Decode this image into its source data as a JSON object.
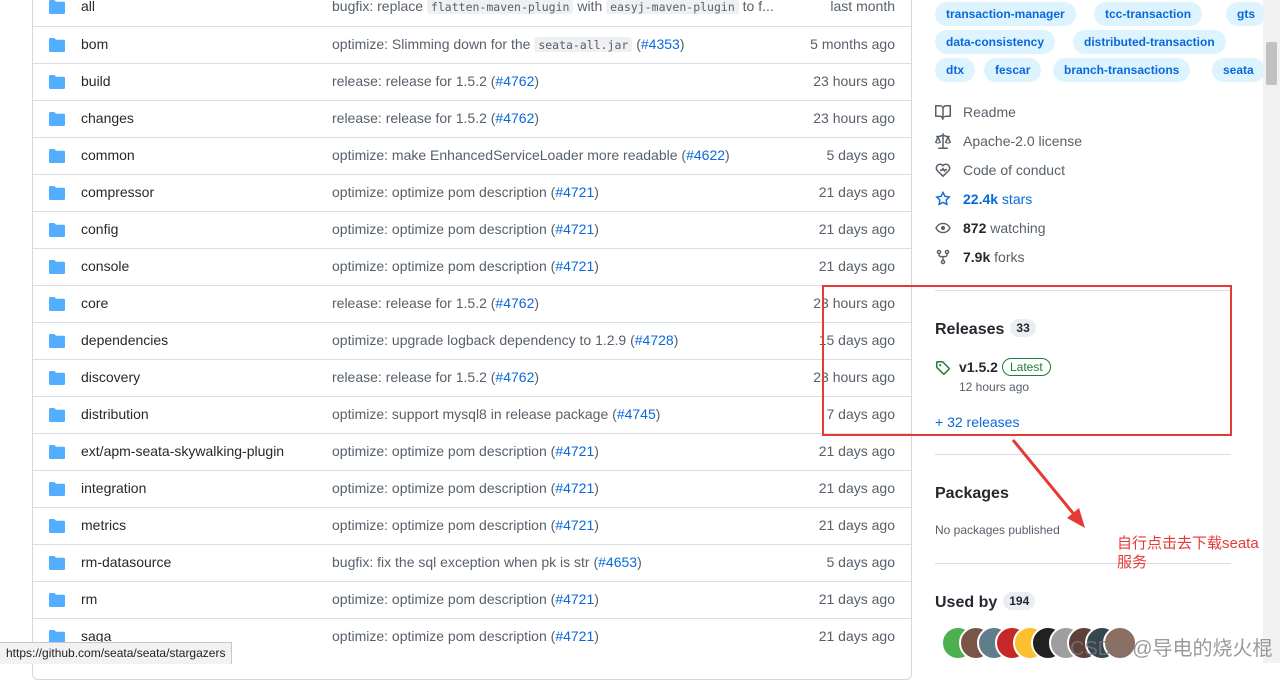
{
  "colors": {
    "folder": "#54aeff",
    "link": "#0969da",
    "muted": "#57606a",
    "tag_bg": "#ddf4ff",
    "annotation": "#e53935",
    "latest": "#1a7f37"
  },
  "files": [
    {
      "name": "all",
      "msg_parts": [
        {
          "t": "text",
          "v": "bugfix: replace "
        },
        {
          "t": "code",
          "v": "flatten-maven-plugin"
        },
        {
          "t": "text",
          "v": " with "
        },
        {
          "t": "code",
          "v": "easyj-maven-plugin"
        },
        {
          "t": "text",
          "v": " to f..."
        }
      ],
      "time": "last month"
    },
    {
      "name": "bom",
      "msg_parts": [
        {
          "t": "text",
          "v": "optimize: Slimming down for the "
        },
        {
          "t": "code",
          "v": "seata-all.jar"
        },
        {
          "t": "text",
          "v": " ("
        },
        {
          "t": "link",
          "v": "#4353"
        },
        {
          "t": "text",
          "v": ")"
        }
      ],
      "time": "5 months ago"
    },
    {
      "name": "build",
      "msg_parts": [
        {
          "t": "text",
          "v": "release: release for 1.5.2 ("
        },
        {
          "t": "link",
          "v": "#4762"
        },
        {
          "t": "text",
          "v": ")"
        }
      ],
      "time": "23 hours ago"
    },
    {
      "name": "changes",
      "msg_parts": [
        {
          "t": "text",
          "v": "release: release for 1.5.2 ("
        },
        {
          "t": "link",
          "v": "#4762"
        },
        {
          "t": "text",
          "v": ")"
        }
      ],
      "time": "23 hours ago"
    },
    {
      "name": "common",
      "msg_parts": [
        {
          "t": "text",
          "v": "optimize: make EnhancedServiceLoader more readable ("
        },
        {
          "t": "link",
          "v": "#4622"
        },
        {
          "t": "text",
          "v": ")"
        }
      ],
      "time": "5 days ago"
    },
    {
      "name": "compressor",
      "msg_parts": [
        {
          "t": "text",
          "v": "optimize: optimize pom description ("
        },
        {
          "t": "link",
          "v": "#4721"
        },
        {
          "t": "text",
          "v": ")"
        }
      ],
      "time": "21 days ago"
    },
    {
      "name": "config",
      "msg_parts": [
        {
          "t": "text",
          "v": "optimize: optimize pom description ("
        },
        {
          "t": "link",
          "v": "#4721"
        },
        {
          "t": "text",
          "v": ")"
        }
      ],
      "time": "21 days ago"
    },
    {
      "name": "console",
      "msg_parts": [
        {
          "t": "text",
          "v": "optimize: optimize pom description ("
        },
        {
          "t": "link",
          "v": "#4721"
        },
        {
          "t": "text",
          "v": ")"
        }
      ],
      "time": "21 days ago"
    },
    {
      "name": "core",
      "msg_parts": [
        {
          "t": "text",
          "v": "release: release for 1.5.2 ("
        },
        {
          "t": "link",
          "v": "#4762"
        },
        {
          "t": "text",
          "v": ")"
        }
      ],
      "time": "23 hours ago"
    },
    {
      "name": "dependencies",
      "msg_parts": [
        {
          "t": "text",
          "v": "optimize: upgrade logback dependency to 1.2.9 ("
        },
        {
          "t": "link",
          "v": "#4728"
        },
        {
          "t": "text",
          "v": ")"
        }
      ],
      "time": "15 days ago"
    },
    {
      "name": "discovery",
      "msg_parts": [
        {
          "t": "text",
          "v": "release: release for 1.5.2 ("
        },
        {
          "t": "link",
          "v": "#4762"
        },
        {
          "t": "text",
          "v": ")"
        }
      ],
      "time": "23 hours ago"
    },
    {
      "name": "distribution",
      "msg_parts": [
        {
          "t": "text",
          "v": "optimize: support mysql8 in release package ("
        },
        {
          "t": "link",
          "v": "#4745"
        },
        {
          "t": "text",
          "v": ")"
        }
      ],
      "time": "7 days ago"
    },
    {
      "name": "ext/apm-seata-skywalking-plugin",
      "msg_parts": [
        {
          "t": "text",
          "v": "optimize: optimize pom description ("
        },
        {
          "t": "link",
          "v": "#4721"
        },
        {
          "t": "text",
          "v": ")"
        }
      ],
      "time": "21 days ago"
    },
    {
      "name": "integration",
      "msg_parts": [
        {
          "t": "text",
          "v": "optimize: optimize pom description ("
        },
        {
          "t": "link",
          "v": "#4721"
        },
        {
          "t": "text",
          "v": ")"
        }
      ],
      "time": "21 days ago"
    },
    {
      "name": "metrics",
      "msg_parts": [
        {
          "t": "text",
          "v": "optimize: optimize pom description ("
        },
        {
          "t": "link",
          "v": "#4721"
        },
        {
          "t": "text",
          "v": ")"
        }
      ],
      "time": "21 days ago"
    },
    {
      "name": "rm-datasource",
      "msg_parts": [
        {
          "t": "text",
          "v": "bugfix: fix the sql exception when pk is str ("
        },
        {
          "t": "link",
          "v": "#4653"
        },
        {
          "t": "text",
          "v": ")"
        }
      ],
      "time": "5 days ago"
    },
    {
      "name": "rm",
      "msg_parts": [
        {
          "t": "text",
          "v": "optimize: optimize pom description ("
        },
        {
          "t": "link",
          "v": "#4721"
        },
        {
          "t": "text",
          "v": ")"
        }
      ],
      "time": "21 days ago"
    },
    {
      "name": "saga",
      "msg_parts": [
        {
          "t": "text",
          "v": "optimize: optimize pom description ("
        },
        {
          "t": "link",
          "v": "#4721"
        },
        {
          "t": "text",
          "v": ")"
        }
      ],
      "time": "21 days ago"
    }
  ],
  "topics": {
    "row1": [
      "transaction-manager",
      "tcc-transaction",
      "gts"
    ],
    "row2": [
      "data-consistency",
      "distributed-transaction"
    ],
    "row3": [
      "dtx",
      "fescar",
      "branch-transactions",
      "seata"
    ]
  },
  "about": {
    "readme": "Readme",
    "license": "Apache-2.0 license",
    "conduct": "Code of conduct",
    "stars_count": "22.4k",
    "stars_label": " stars",
    "watching_count": "872",
    "watching_label": " watching",
    "forks_count": "7.9k",
    "forks_label": " forks"
  },
  "releases": {
    "title": "Releases",
    "count": "33",
    "version": "v1.5.2",
    "latest_badge": "Latest",
    "time": "12 hours ago",
    "more_link": "+ 32 releases"
  },
  "packages": {
    "title": "Packages",
    "empty": "No packages published"
  },
  "used_by": {
    "title": "Used by",
    "count": "194",
    "avatar_colors": [
      "#4caf50",
      "#795548",
      "#607d8b",
      "#c62828",
      "#fbc02d",
      "#212121",
      "#9e9e9e",
      "#5d4037",
      "#37474f",
      "#8d6e63"
    ]
  },
  "annotation": {
    "text": "自行点击去下载seata服务"
  },
  "status_url": "https://github.com/seata/seata/stargazers",
  "watermark": "CSDN @导电的烧火棍"
}
